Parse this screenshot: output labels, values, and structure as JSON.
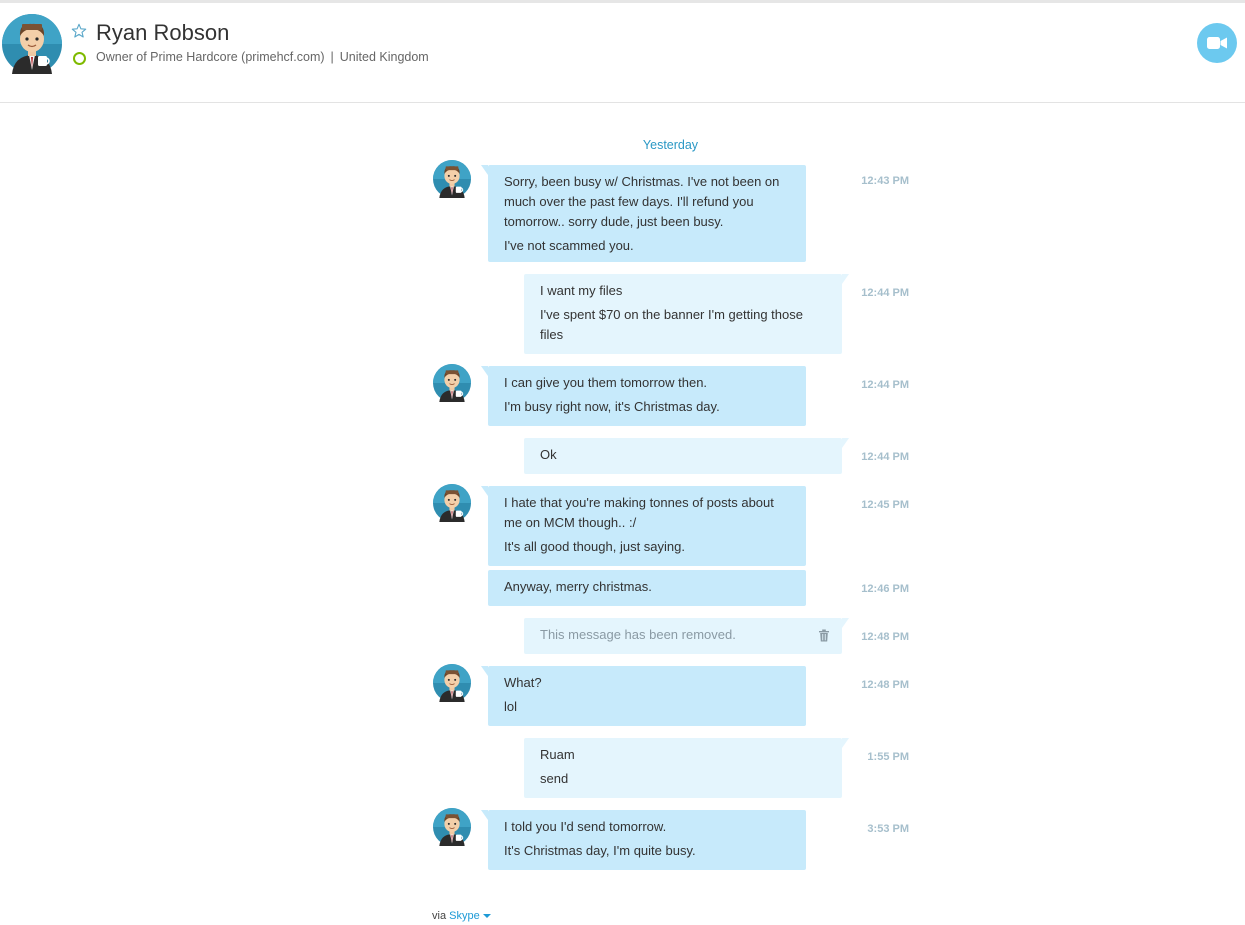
{
  "header": {
    "name": "Ryan Robson",
    "mood": "Owner of Prime Hardcore (primehcf.com)",
    "separator": "|",
    "location": "United Kingdom"
  },
  "conversation": {
    "day_label": "Yesterday",
    "messages": [
      {
        "from": "contact",
        "time": "12:43 PM",
        "paragraphs": [
          "Sorry, been busy w/ Christmas. I've not been on much over the past few days. I'll refund you tomorrow.. sorry dude, just been busy.",
          "I've not scammed you."
        ]
      },
      {
        "from": "me",
        "time": "12:44 PM",
        "paragraphs": [
          "I want my files",
          "I've spent $70 on the banner I'm getting those files"
        ]
      },
      {
        "from": "contact",
        "time": "12:44 PM",
        "paragraphs": [
          "I can give you them tomorrow then.",
          "I'm busy right now, it's Christmas day."
        ]
      },
      {
        "from": "me",
        "time": "12:44 PM",
        "paragraphs": [
          "Ok"
        ]
      },
      {
        "from": "contact",
        "time": "12:45 PM",
        "paragraphs": [
          "I hate that you're making tonnes of posts about me on MCM though.. :/",
          "It's all good though, just saying."
        ]
      },
      {
        "from": "contact",
        "time": "12:46 PM",
        "paragraphs": [
          "Anyway, merry christmas."
        ]
      },
      {
        "from": "me",
        "time": "12:48 PM",
        "paragraphs": [
          "This message has been removed."
        ]
      },
      {
        "from": "contact",
        "time": "12:48 PM",
        "paragraphs": [
          "What?",
          "lol"
        ]
      },
      {
        "from": "me",
        "time": "1:55 PM",
        "paragraphs": [
          "Ruam",
          "send"
        ]
      },
      {
        "from": "contact",
        "time": "3:53 PM",
        "paragraphs": [
          "I told you I'd send tomorrow.",
          "It's Christmas day, I'm quite busy."
        ]
      }
    ]
  },
  "footer": {
    "via": "via",
    "service": "Skype"
  },
  "colors": {
    "accent": "#2a98c5",
    "incoming_bubble": "#c7eafb",
    "outgoing_bubble": "#e4f5fd",
    "presence": "#7fba00",
    "video_button": "#6cc9ef"
  },
  "icons": [
    "favorite-star-icon",
    "presence-icon",
    "video-call-icon",
    "trash-icon",
    "dropdown-caret-icon"
  ]
}
